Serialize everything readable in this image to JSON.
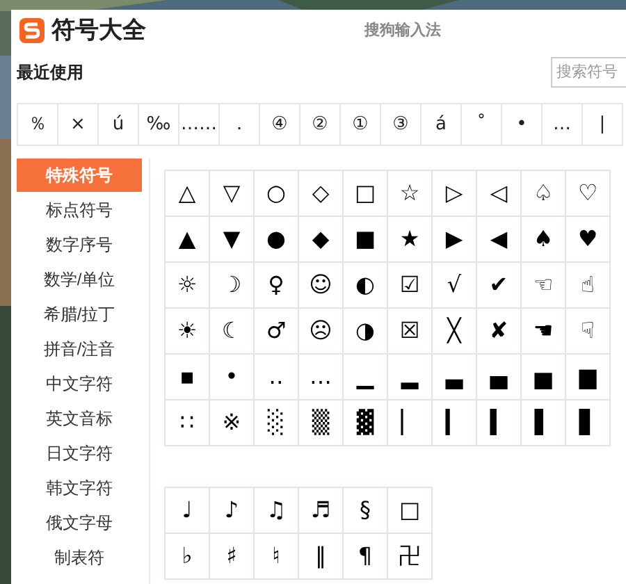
{
  "window": {
    "title": "符号大全",
    "subtitle": "搜狗输入法"
  },
  "recent": {
    "label": "最近使用",
    "symbols": [
      "％",
      "×",
      "ú",
      "‰",
      "……",
      "．",
      "④",
      "②",
      "①",
      "③",
      "á",
      "˚",
      "•",
      "…",
      "|"
    ]
  },
  "search": {
    "placeholder": "搜索符号"
  },
  "sidebar": {
    "items": [
      {
        "label": "特殊符号",
        "selected": true
      },
      {
        "label": "标点符号",
        "selected": false
      },
      {
        "label": "数字序号",
        "selected": false
      },
      {
        "label": "数学/单位",
        "selected": false
      },
      {
        "label": "希腊/拉丁",
        "selected": false
      },
      {
        "label": "拼音/注音",
        "selected": false
      },
      {
        "label": "中文字符",
        "selected": false
      },
      {
        "label": "英文音标",
        "selected": false
      },
      {
        "label": "日文字符",
        "selected": false
      },
      {
        "label": "韩文字符",
        "selected": false
      },
      {
        "label": "俄文字母",
        "selected": false
      },
      {
        "label": "制表符",
        "selected": false
      }
    ]
  },
  "grids": [
    {
      "rows": [
        [
          "△",
          "▽",
          "○",
          "◇",
          "□",
          "☆",
          "▷",
          "◁",
          "♤",
          "♡"
        ],
        [
          "▲",
          "▼",
          "●",
          "◆",
          "■",
          "★",
          "▶",
          "◀",
          "♠",
          "♥"
        ],
        [
          "☼",
          "☽",
          "♀",
          "☺",
          "◐",
          "☑",
          "√",
          "✔",
          "☜",
          "☝"
        ],
        [
          "☀",
          "☾",
          "♂",
          "☹",
          "◑",
          "☒",
          "╳",
          "✘",
          "☚",
          "☟"
        ],
        [
          "▪",
          "•",
          "‥",
          "…",
          "▁",
          "▂",
          "▃",
          "▄",
          "▅",
          "▆"
        ],
        [
          "∷",
          "※",
          "░",
          "▒",
          "▓",
          "▏",
          "▎",
          "▍",
          "▌",
          "▋"
        ]
      ]
    },
    {
      "rows": [
        [
          "♩",
          "♪",
          "♫",
          "♬",
          "§",
          "□"
        ],
        [
          "♭",
          "♯",
          "♮",
          "‖",
          "¶",
          "卍"
        ]
      ]
    }
  ]
}
